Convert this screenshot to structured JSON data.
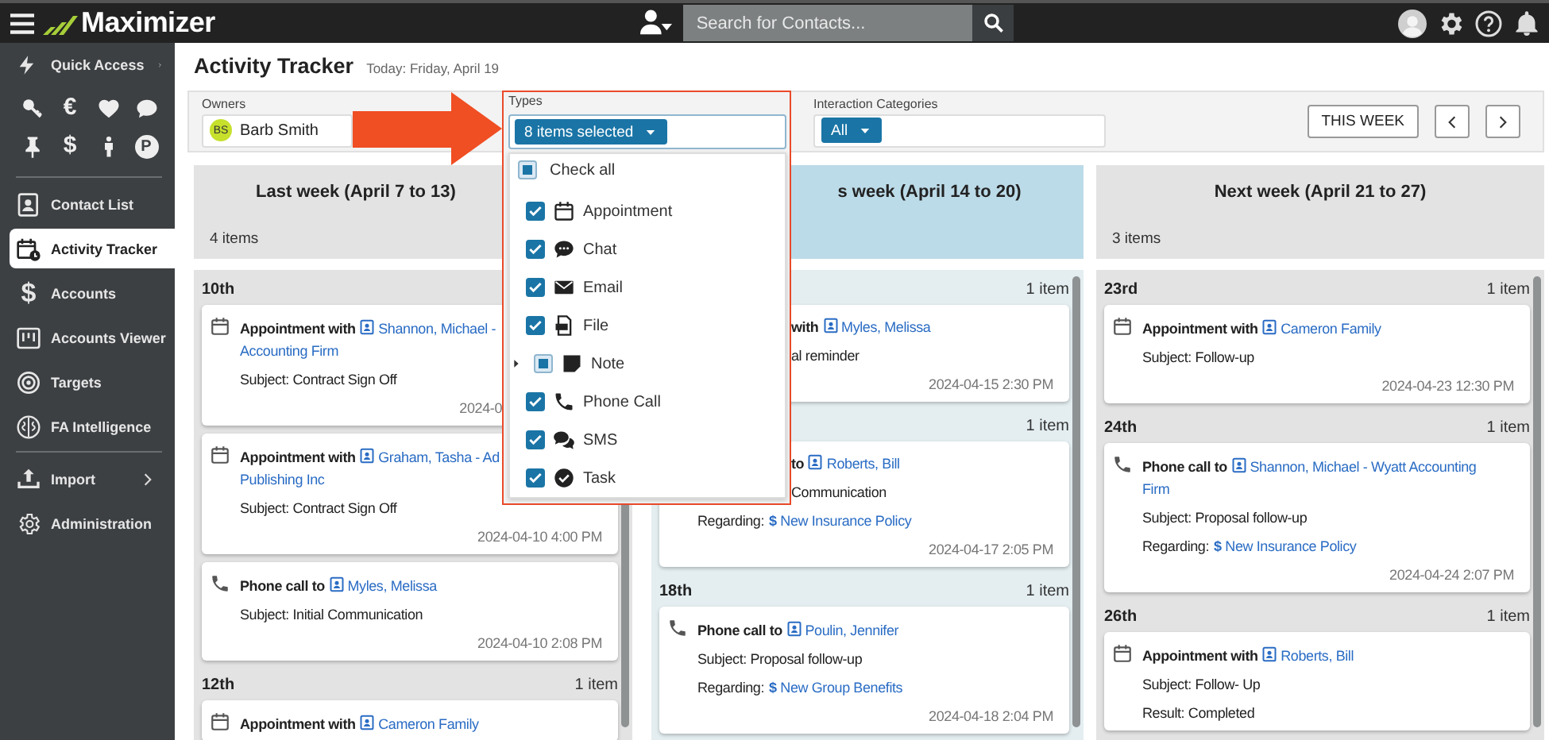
{
  "top_bar": {
    "logo": "Maximizer",
    "search": {
      "placeholder": "Search for Contacts..."
    }
  },
  "sidebar": {
    "quick_access": "Quick Access",
    "shortcuts": [
      {
        "kind": "key"
      },
      {
        "kind": "glyph",
        "text": "€"
      },
      {
        "kind": "heart"
      },
      {
        "kind": "chat"
      },
      {
        "kind": "pin"
      },
      {
        "kind": "glyph",
        "text": "$"
      },
      {
        "kind": "person"
      },
      {
        "kind": "badge",
        "text": "P"
      }
    ],
    "items": [
      {
        "kind": "contacts",
        "label": "Contact List",
        "selected": false
      },
      {
        "kind": "tracker",
        "label": "Activity Tracker",
        "selected": true
      },
      {
        "kind": "glyph",
        "glyph": "$",
        "label": "Accounts",
        "selected": false
      },
      {
        "kind": "viewer",
        "label": "Accounts Viewer",
        "selected": false
      },
      {
        "kind": "target",
        "label": "Targets",
        "selected": false
      },
      {
        "kind": "brain",
        "label": "FA Intelligence",
        "selected": false
      }
    ],
    "admin_items": [
      {
        "kind": "upload",
        "label": "Import"
      },
      {
        "kind": "gear",
        "label": "Administration"
      }
    ]
  },
  "page": {
    "title": "Activity Tracker",
    "today": "Today: Friday, April 19"
  },
  "filters": {
    "owners": {
      "label": "Owners",
      "initials": "BS",
      "name": "Barb Smith"
    },
    "types": {
      "label": "Types",
      "value": "8 items selected",
      "check_all": {
        "label": "Check all",
        "checked": false,
        "partial": true
      },
      "options": [
        {
          "kind": "appointment",
          "label": "Appointment",
          "checked": true,
          "partial": false,
          "has_children": false
        },
        {
          "kind": "chat",
          "label": "Chat",
          "checked": true,
          "partial": false,
          "has_children": false
        },
        {
          "kind": "email",
          "label": "Email",
          "checked": true,
          "partial": false,
          "has_children": false
        },
        {
          "kind": "file",
          "label": "File",
          "checked": true,
          "partial": false,
          "has_children": false
        },
        {
          "kind": "note",
          "label": "Note",
          "checked": false,
          "partial": true,
          "has_children": true
        },
        {
          "kind": "phone",
          "label": "Phone Call",
          "checked": true,
          "partial": false,
          "has_children": false
        },
        {
          "kind": "sms",
          "label": "SMS",
          "checked": true,
          "partial": false,
          "has_children": false
        },
        {
          "kind": "task",
          "label": "Task",
          "checked": true,
          "partial": false,
          "has_children": false
        }
      ]
    },
    "categories": {
      "label": "Interaction Categories",
      "value": "All"
    },
    "this_week": "THIS WEEK"
  },
  "columns": [
    {
      "title": "Last week (April 7 to 13)",
      "count": "4 items",
      "current": false,
      "groups": [
        {
          "day": "10th",
          "cards": [
            {
              "kind": "appointment",
              "title": "Appointment with",
              "contact_lines": [
                "Shannon, Michael -",
                "Accounting Firm"
              ],
              "lines": [
                {
                  "kind": "text",
                  "text": "Subject: Contract Sign Off"
                }
              ],
              "date": "2024-0"
            },
            {
              "kind": "appointment",
              "title": "Appointment with",
              "contact_lines": [
                "Graham, Tasha - Ad",
                "Publishing Inc"
              ],
              "lines": [
                {
                  "kind": "text",
                  "text": "Subject: Contract Sign Off"
                }
              ],
              "date": "2024-04-10 4:00 PM"
            },
            {
              "kind": "phone",
              "title": "Phone call to",
              "contact_lines": [
                "Myles, Melissa"
              ],
              "lines": [
                {
                  "kind": "text",
                  "text": "Subject: Initial Communication"
                }
              ],
              "date": "2024-04-10 2:08 PM"
            }
          ]
        },
        {
          "day": "12th",
          "count": "1 item",
          "cards": [
            {
              "kind": "appointment",
              "title": "Appointment with",
              "contact_lines": [
                "Cameron Family"
              ]
            }
          ]
        }
      ]
    },
    {
      "title": "s week (April 14 to 20)",
      "current": true,
      "groups": [
        {
          "count": "1 item",
          "cards": [
            {
              "title": "with",
              "contact_lines": [
                "Myles, Melissa"
              ],
              "lines": [
                {
                  "kind": "text",
                  "text": "al reminder"
                }
              ],
              "date": "2024-04-15 2:30 PM"
            }
          ]
        },
        {
          "count": "1 item",
          "cards": [
            {
              "title": "to",
              "contact_lines": [
                "Roberts, Bill"
              ],
              "lines": [
                {
                  "kind": "text",
                  "text": "Communication"
                },
                {
                  "kind": "regarding",
                  "label": "Regarding:",
                  "symbol": "$",
                  "link": "New Insurance Policy"
                }
              ],
              "date": "2024-04-17 2:05 PM"
            }
          ]
        },
        {
          "day": "18th",
          "count": "1 item",
          "cards": [
            {
              "kind": "phone",
              "title": "Phone call to",
              "contact_lines": [
                "Poulin, Jennifer"
              ],
              "lines": [
                {
                  "kind": "text",
                  "text": "Subject: Proposal follow-up"
                },
                {
                  "kind": "regarding",
                  "label": "Regarding:",
                  "symbol": "$",
                  "link": "New Group Benefits"
                }
              ],
              "date": "2024-04-18 2:04 PM"
            }
          ]
        }
      ]
    },
    {
      "title": "Next week (April 21 to 27)",
      "count": "3 items",
      "current": false,
      "groups": [
        {
          "day": "23rd",
          "count": "1 item",
          "cards": [
            {
              "kind": "appointment",
              "title": "Appointment with",
              "contact_lines": [
                "Cameron Family"
              ],
              "lines": [
                {
                  "kind": "text",
                  "text": "Subject: Follow-up"
                }
              ],
              "date": "2024-04-23 12:30 PM"
            }
          ]
        },
        {
          "day": "24th",
          "count": "1 item",
          "cards": [
            {
              "kind": "phone",
              "title": "Phone call to",
              "contact_lines": [
                "Shannon, Michael - Wyatt Accounting",
                "Firm"
              ],
              "lines": [
                {
                  "kind": "text",
                  "text": "Subject: Proposal follow-up"
                },
                {
                  "kind": "regarding",
                  "label": "Regarding:",
                  "symbol": "$",
                  "link": "New Insurance Policy"
                }
              ],
              "date": "2024-04-24 2:07 PM"
            }
          ]
        },
        {
          "day": "26th",
          "count": "1 item",
          "cards": [
            {
              "kind": "appointment",
              "title": "Appointment with",
              "contact_lines": [
                "Roberts, Bill"
              ],
              "lines": [
                {
                  "kind": "text",
                  "text": "Subject: Follow- Up"
                },
                {
                  "kind": "text",
                  "text": "Result: Completed"
                }
              ]
            }
          ]
        }
      ]
    }
  ]
}
